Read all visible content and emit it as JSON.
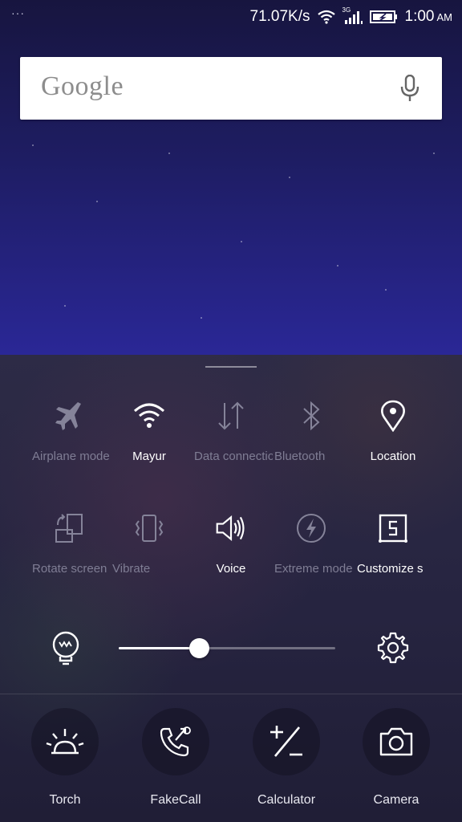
{
  "status_bar": {
    "dots": "···",
    "net_speed": "71.07K/s",
    "network_type": "3G",
    "time": "1:00",
    "ampm": "AM",
    "icons": [
      "wifi-icon",
      "signal-icon",
      "battery-icon"
    ]
  },
  "search": {
    "logo": "Google",
    "mic_icon": "mic-icon"
  },
  "quick_settings": {
    "row1": [
      {
        "label": "Airplane mode",
        "icon": "airplane-icon",
        "active": false
      },
      {
        "label": "Mayur",
        "icon": "wifi-icon",
        "active": true
      },
      {
        "label": "Data connection",
        "icon": "data-connection-icon",
        "active": false
      },
      {
        "label": "Bluetooth",
        "icon": "bluetooth-icon",
        "active": false
      },
      {
        "label": "Location",
        "icon": "location-icon",
        "active": true
      }
    ],
    "row2": [
      {
        "label": "Rotate screen",
        "icon": "rotate-icon",
        "active": false
      },
      {
        "label": "Vibrate",
        "icon": "vibrate-icon",
        "active": false
      },
      {
        "label": "Voice",
        "icon": "speaker-icon",
        "active": true
      },
      {
        "label": "Extreme mode",
        "icon": "lightning-icon",
        "active": false
      },
      {
        "label": "Customize s",
        "icon": "customize-icon",
        "active": true
      }
    ]
  },
  "brightness": {
    "level": 0.37,
    "auto_icon": "bulb-icon",
    "settings_icon": "gear-icon"
  },
  "shortcuts": [
    {
      "label": "Torch",
      "icon": "torch-icon"
    },
    {
      "label": "FakeCall",
      "icon": "fakecall-icon"
    },
    {
      "label": "Calculator",
      "icon": "calculator-icon"
    },
    {
      "label": "Camera",
      "icon": "camera-icon"
    }
  ],
  "colors": {
    "active": "#ffffff",
    "inactive": "#7f7d94",
    "panel": "#2a2844"
  }
}
